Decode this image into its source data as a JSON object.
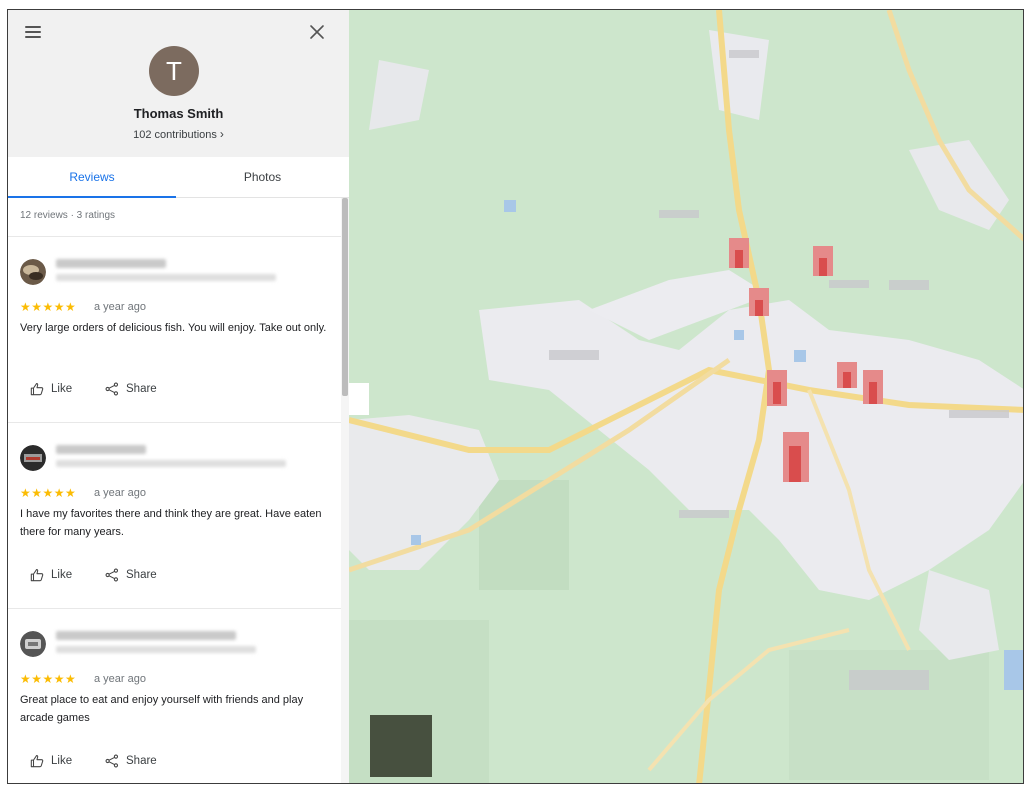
{
  "profile": {
    "initial": "T",
    "name": "Thomas Smith",
    "contributions": "102 contributions",
    "avatar_color": "#7c6b5f"
  },
  "tabs": [
    {
      "label": "Reviews",
      "active": true
    },
    {
      "label": "Photos",
      "active": false
    }
  ],
  "summary": "12 reviews · 3 ratings",
  "reviews": [
    {
      "stars": "★★★★★",
      "rating": 5,
      "time": "a year ago",
      "text": "Very large orders of delicious fish. You will enjoy. Take out only.",
      "like_label": "Like",
      "share_label": "Share"
    },
    {
      "stars": "★★★★★",
      "rating": 5,
      "time": "a year ago",
      "text": "I have my favorites there and think they are great. Have eaten there for many years.",
      "like_label": "Like",
      "share_label": "Share"
    },
    {
      "stars": "★★★★★",
      "rating": 5,
      "time": "a year ago",
      "text": "Great place to eat and enjoy yourself with friends and play arcade games",
      "like_label": "Like",
      "share_label": "Share"
    }
  ],
  "colors": {
    "accent": "#1a73e8",
    "star": "#fbbc04",
    "map_green": "#cde6cc",
    "map_urban": "#ececf0",
    "map_road": "#f3d98a",
    "map_pin": "#e06262"
  },
  "icons": {
    "menu": "hamburger-menu-icon",
    "close": "close-x-icon",
    "like": "thumb-up-icon",
    "share": "share-icon",
    "chevron": "chevron-right-icon"
  }
}
